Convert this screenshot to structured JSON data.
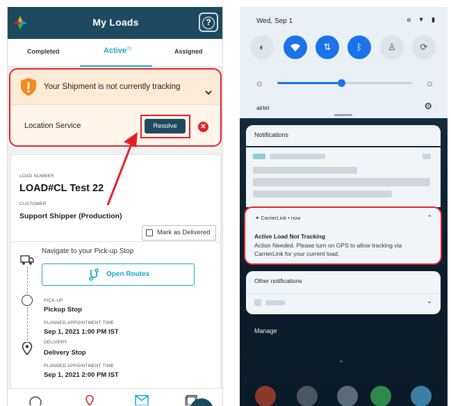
{
  "left": {
    "header": {
      "title": "My Loads",
      "help_icon": "question-circle-icon"
    },
    "tabs": [
      {
        "label": "Completed"
      },
      {
        "label": "Active",
        "badge": "(1)"
      },
      {
        "label": "Assigned"
      }
    ],
    "alert": {
      "message": "Your Shipment is not currently tracking",
      "location_label": "Location Service",
      "resolve_label": "Resolve"
    },
    "load": {
      "load_number_label": "LOAD NUMBER",
      "load_number": "LOAD#CL Test 22",
      "customer_label": "CUSTOMER",
      "customer": "Support Shipper (Production)",
      "mark_delivered": "Mark as Delivered"
    },
    "route": {
      "navigate_text": "Navigate to your Pick-up Stop",
      "open_routes": "Open Routes",
      "pickup_label": "PICK-UP",
      "pickup_title": "Pickup Stop",
      "pickup_appt_label": "PLANNED APPOINTMENT TIME",
      "pickup_time": "Sep 1, 2021 1:00 PM IST",
      "delivery_label": "DELIVERY",
      "delivery_title": "Delivery Stop",
      "delivery_appt_label": "PLANNED APPOINTMENT TIME",
      "delivery_time": "Sep 1, 2021 2:00 PM IST"
    },
    "colors": {
      "brand": "#1d4a5f",
      "accent": "#19a6c8",
      "highlight": "#e2202a"
    }
  },
  "right": {
    "status": {
      "date": "Wed, Sep 1",
      "icons": "⌀ ▼ ▮"
    },
    "carrier": "airtel",
    "notifications_header": "Notifications",
    "carrierlink": {
      "app": "CarrierLink • now",
      "title": "Active Load Not Tracking",
      "body": "Action Needed. Please turn on GPS to allow tracking via CarrierLink for your current load."
    },
    "other_header": "Other notifications",
    "manage": "Manage"
  }
}
